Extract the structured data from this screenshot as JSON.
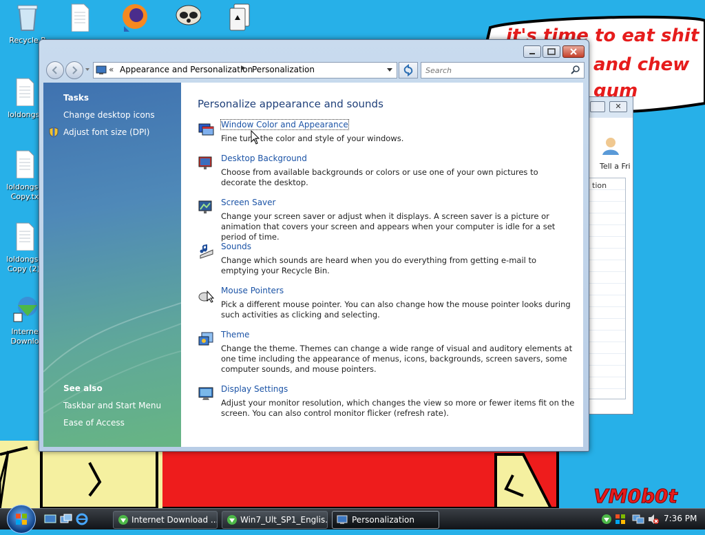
{
  "desktop": {
    "icons": [
      {
        "label": "Recycle B"
      },
      {
        "label": ""
      },
      {
        "label": ""
      },
      {
        "label": ""
      },
      {
        "label": ""
      },
      {
        "label": "loldongs."
      },
      {
        "label": "loldongs -\nCopy.tx"
      },
      {
        "label": "loldongs -\nCopy (2)."
      },
      {
        "label": "Interne\nDownlo"
      }
    ],
    "graffiti_text_1": "it's time to eat shit",
    "graffiti_text_2": "and chew",
    "graffiti_text_3": "gum",
    "watermark": "VM0b0t"
  },
  "background_window": {
    "label_1": "Tell a Fri",
    "label_2": "tion"
  },
  "window": {
    "nav": {
      "breadcrumb_prefix": "«",
      "breadcrumb": [
        "Appearance and Personalization",
        "Personalization"
      ],
      "search_placeholder": "Search"
    },
    "sidebar": {
      "tasks_header": "Tasks",
      "tasks": [
        {
          "label": "Change desktop icons"
        },
        {
          "label": "Adjust font size (DPI)"
        }
      ],
      "see_also_header": "See also",
      "see_also": [
        {
          "label": "Taskbar and Start Menu"
        },
        {
          "label": "Ease of Access"
        }
      ]
    },
    "main": {
      "title": "Personalize appearance and sounds",
      "items": [
        {
          "title": "Window Color and Appearance",
          "desc": "Fine tune the color and style of your windows.",
          "icon": "window-color-icon"
        },
        {
          "title": "Desktop Background",
          "desc": "Choose from available backgrounds or colors or use one of your own pictures to decorate the desktop.",
          "icon": "desktop-background-icon"
        },
        {
          "title": "Screen Saver",
          "desc": "Change your screen saver or adjust when it displays. A screen saver is a picture or animation that covers your screen and appears when your computer is idle for a set period of time.",
          "icon": "screen-saver-icon"
        },
        {
          "title": "Sounds",
          "desc": "Change which sounds are heard when you do everything from getting e-mail to emptying your Recycle Bin.",
          "icon": "sounds-icon"
        },
        {
          "title": "Mouse Pointers",
          "desc": "Pick a different mouse pointer. You can also change how the mouse pointer looks during such activities as clicking and selecting.",
          "icon": "mouse-pointer-icon"
        },
        {
          "title": "Theme",
          "desc": "Change the theme. Themes can change a wide range of visual and auditory elements at one time including the appearance of menus, icons, backgrounds, screen savers, some computer sounds, and mouse pointers.",
          "icon": "theme-icon"
        },
        {
          "title": "Display Settings",
          "desc": "Adjust your monitor resolution, which changes the view so more or fewer items fit on the screen. You can also control monitor flicker (refresh rate).",
          "icon": "display-settings-icon"
        }
      ]
    }
  },
  "taskbar": {
    "buttons": [
      {
        "label": "Internet Download ..."
      },
      {
        "label": "Win7_Ult_SP1_Englis..."
      },
      {
        "label": "Personalization"
      }
    ],
    "clock": "7:36 PM"
  },
  "colors": {
    "link": "#1b53a6",
    "desktop_bg": "#27b0e8",
    "taskbar": "#1a1e22"
  }
}
